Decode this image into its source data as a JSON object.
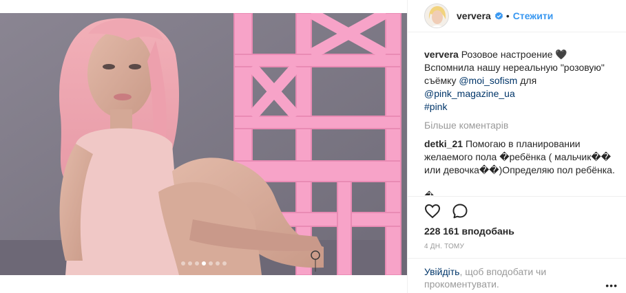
{
  "post": {
    "image_alt": "Photo of a woman with pink hair sitting next to pink chairs",
    "carousel": {
      "count": 7,
      "active_index": 3
    }
  },
  "header": {
    "username": "ververa",
    "separator": "•",
    "follow_label": "Стежити"
  },
  "caption": {
    "username": "ververa",
    "text_1": "Розовое настроение 🖤",
    "text_2": "Вспомнила нашу нереальную \"розовую\" съёмку ",
    "mention_1": "@moi_sofism",
    "text_3": " для",
    "mention_2": "@pink_magazine_ua",
    "hashtag": "#pink"
  },
  "load_more_label": "Більше коментарів",
  "comment": {
    "username": "detki_21",
    "text": "Помогаю в планировании желаемого пола �ребёнка ( мальчик�� или девочка��)Определяю пол ребёнка.",
    "trailing": "�"
  },
  "likes": {
    "text": "228 161 вподобань"
  },
  "timestamp": "4 дн. тому",
  "footer": {
    "login_link": "Увійдіть",
    "rest": ", щоб вподобати чи прокоментувати."
  },
  "options_label": "•••",
  "icons": {
    "like": "heart-icon",
    "comment": "comment-icon",
    "verified": "verified-badge-icon",
    "more": "more-options-icon"
  },
  "colors": {
    "link_blue": "#3897f0",
    "mention": "#003569",
    "muted": "#999999",
    "text": "#262626",
    "chair_pink": "#ff9fc9"
  }
}
